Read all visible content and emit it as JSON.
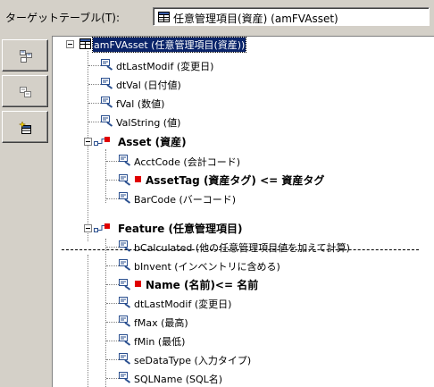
{
  "target": {
    "label": "ターゲットテーブル(T):",
    "value": "任意管理項目(資産) (amFVAsset)"
  },
  "toolbar": {
    "buttons": [
      {
        "name": "table-icon"
      },
      {
        "name": "field-icon"
      },
      {
        "name": "add-icon"
      }
    ]
  },
  "tree": {
    "root": "amFVAsset (任意管理項目(資産))",
    "fields": [
      "dtLastModif (変更日)",
      "dtVal (日付値)",
      "fVal (数値)",
      "ValString (値)"
    ],
    "asset": {
      "label": "Asset (資産)",
      "children": [
        "AcctCode (会計コード)",
        "AssetTag (資産タグ)  <=   資産タグ",
        "BarCode (バーコード)"
      ]
    },
    "feature": {
      "label": "Feature (任意管理項目)",
      "children": [
        "bCalculated (他の任意管理項目値を加えて計算)",
        "bInvent (インベントリに含める)",
        "Name (名前)<=   名前",
        "dtLastModif (変更日)",
        "fMax (最高)",
        "fMin (最低)",
        "seDataType (入力タイプ)",
        "SQLName (SQL名)"
      ]
    }
  },
  "colors": {
    "selection": "#0a246a",
    "marker": "#e00000",
    "field_icon": "#2a4f8f"
  }
}
